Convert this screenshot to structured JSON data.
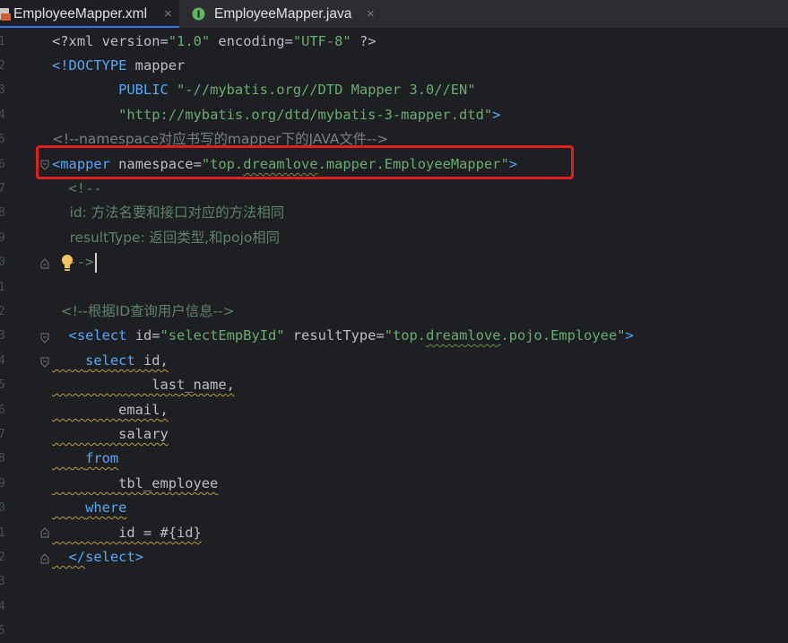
{
  "tabs": [
    {
      "label": "EmployeeMapper.xml",
      "icon": "xml-file-icon",
      "active": true,
      "close": "×"
    },
    {
      "label": "EmployeeMapper.java",
      "icon": "java-interface-icon",
      "active": false,
      "close": "×"
    }
  ],
  "gutter": {
    "line_numbers": [
      "1",
      "2",
      "3",
      "4",
      "5",
      "6",
      "7",
      "8",
      "9",
      "0",
      "1",
      "2",
      "3",
      "4",
      "5",
      "6",
      "7",
      "8",
      "9",
      "0",
      "1",
      "2",
      "3",
      "4",
      "5"
    ]
  },
  "code": {
    "l1": [
      "<?",
      "xml",
      " version",
      "=",
      "\"1.0\"",
      " encoding",
      "=",
      "\"UTF-8\"",
      " ?>"
    ],
    "l2": [
      "<!DOCTYPE",
      " mapper"
    ],
    "l3": [
      "        PUBLIC",
      " ",
      "\"-//mybatis.org//DTD Mapper 3.0//EN\""
    ],
    "l4": [
      "        ",
      "\"http://mybatis.org/dtd/mybatis-3-mapper.dtd\"",
      ">"
    ],
    "l5": "<!--namespace对应书写的mapper下的JAVA文件-->",
    "l6": [
      "<",
      "mapper",
      " namespace",
      "=",
      "\"top.",
      "dreamlove",
      ".mapper.EmployeeMapper\"",
      ">"
    ],
    "l7": "  <!--",
    "l8": "    id: 方法名要和接口对应的方法相同",
    "l9": "    resultType: 返回类型,和pojo相同",
    "l10": "  -->",
    "l12": "  <!--根据ID查询用户信息-->",
    "l13": [
      "  <",
      "select",
      " id",
      "=",
      "\"selectEmpById\"",
      " resultType",
      "=",
      "\"top.",
      "dreamlove",
      ".pojo.Employee\"",
      ">"
    ],
    "l14": [
      "    ",
      "select",
      " id",
      ","
    ],
    "l15": [
      "            last_name",
      ","
    ],
    "l16": [
      "        email",
      ","
    ],
    "l17": "        salary",
    "l18": [
      "    ",
      "from"
    ],
    "l19": "        tbl_employee",
    "l20": [
      "    ",
      "where"
    ],
    "l21": "        id = #{id}",
    "l22": [
      "  </",
      "select",
      ">"
    ]
  },
  "colors": {
    "background": "#1e1f22",
    "tag": "#56a8f5",
    "string": "#6aab73",
    "comment": "#7a7e85",
    "highlight_box": "#e01f1f"
  }
}
